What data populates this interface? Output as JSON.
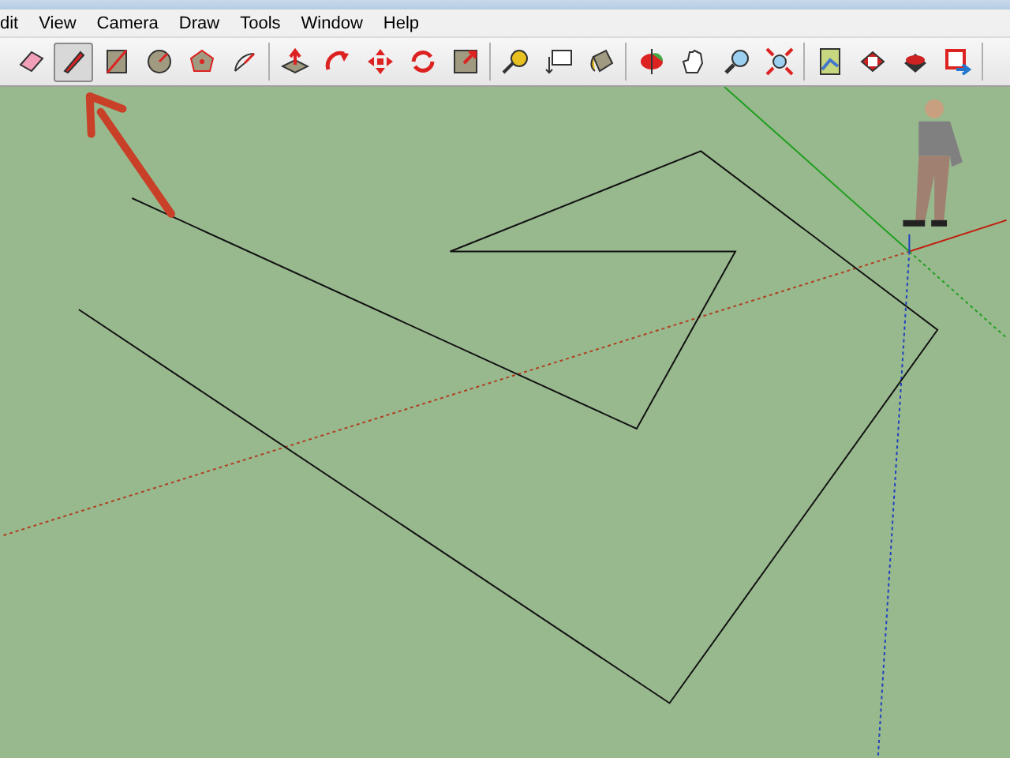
{
  "menu": [
    "dit",
    "View",
    "Camera",
    "Draw",
    "Tools",
    "Window",
    "Help"
  ],
  "toolbar": [
    [
      {
        "kind": "eraser",
        "selected": false
      },
      {
        "kind": "pencil",
        "selected": true
      },
      {
        "kind": "rectangle",
        "selected": false
      },
      {
        "kind": "circle",
        "selected": false
      },
      {
        "kind": "polygon",
        "selected": false
      },
      {
        "kind": "arc",
        "selected": false
      }
    ],
    [
      {
        "kind": "pushpull",
        "selected": false
      },
      {
        "kind": "followme",
        "selected": false
      },
      {
        "kind": "move",
        "selected": false
      },
      {
        "kind": "rotate",
        "selected": false
      },
      {
        "kind": "scale",
        "selected": false
      }
    ],
    [
      {
        "kind": "tape",
        "selected": false
      },
      {
        "kind": "text",
        "selected": false
      },
      {
        "kind": "paint",
        "selected": false
      }
    ],
    [
      {
        "kind": "orbit",
        "selected": false
      },
      {
        "kind": "pan",
        "selected": false
      },
      {
        "kind": "zoom",
        "selected": false
      },
      {
        "kind": "extents",
        "selected": false
      }
    ],
    [
      {
        "kind": "map",
        "selected": false
      },
      {
        "kind": "component",
        "selected": false
      },
      {
        "kind": "warehouse",
        "selected": false
      },
      {
        "kind": "share",
        "selected": false
      }
    ]
  ]
}
